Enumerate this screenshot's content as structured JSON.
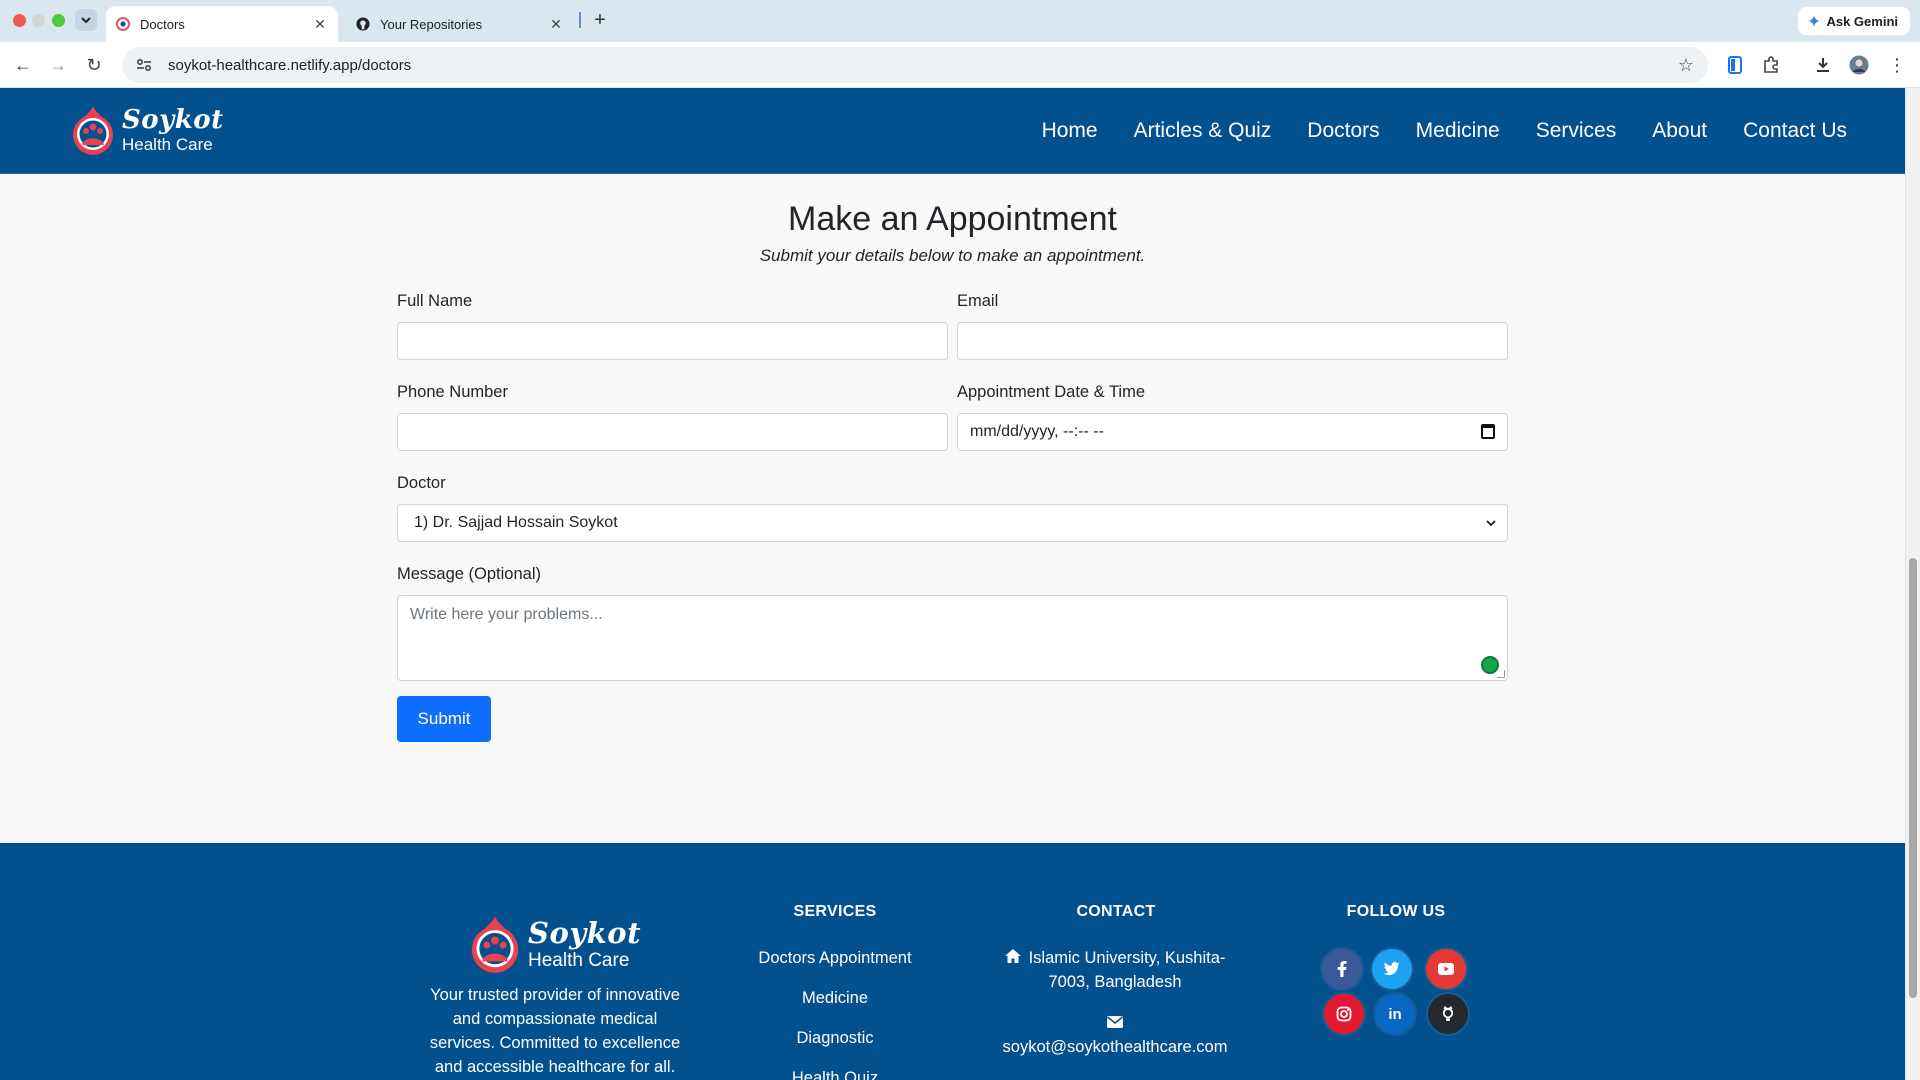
{
  "browser": {
    "tabs": [
      {
        "title": "Doctors",
        "active": true
      },
      {
        "title": "Your Repositories",
        "active": false
      }
    ],
    "url": "soykot-healthcare.netlify.app/doctors",
    "ask_gemini": "Ask Gemini"
  },
  "header": {
    "logo_brand": "Soykot",
    "logo_tagline": "Health Care",
    "nav": [
      "Home",
      "Articles & Quiz",
      "Doctors",
      "Medicine",
      "Services",
      "About",
      "Contact Us"
    ]
  },
  "appointment": {
    "title": "Make an Appointment",
    "subtitle": "Submit your details below to make an appointment.",
    "full_name_label": "Full Name",
    "full_name_value": "",
    "email_label": "Email",
    "email_value": "",
    "phone_label": "Phone Number",
    "phone_value": "",
    "datetime_label": "Appointment Date & Time",
    "datetime_placeholder": "mm/dd/yyyy, --:-- --",
    "doctor_label": "Doctor",
    "doctor_selected": "1) Dr. Sajjad Hossain Soykot",
    "message_label": "Message (Optional)",
    "message_placeholder": "Write here your problems...",
    "submit_label": "Submit"
  },
  "footer": {
    "logo_brand": "Soykot",
    "logo_tagline": "Health Care",
    "description": "Your trusted provider of innovative and compassionate medical services. Committed to excellence and accessible healthcare for all.",
    "services_heading": "SERVICES",
    "services": [
      "Doctors Appointment",
      "Medicine",
      "Diagnostic",
      "Health Quiz"
    ],
    "contact_heading": "CONTACT",
    "address": "Islamic University, Kushita-7003, Bangladesh",
    "email": "soykot@soykothealthcare.com",
    "follow_heading": "FOLLOW US",
    "social": [
      {
        "name": "facebook",
        "color": "#3b5998"
      },
      {
        "name": "twitter",
        "color": "#1da1f2"
      },
      {
        "name": "youtube",
        "color": "#e53935"
      },
      {
        "name": "instagram",
        "color": "#e4192f"
      },
      {
        "name": "linkedin",
        "color": "#0a66c2"
      },
      {
        "name": "github",
        "color": "#24292e"
      }
    ]
  },
  "colors": {
    "brand_blue": "#03508e",
    "primary_button": "#0d6efd"
  }
}
